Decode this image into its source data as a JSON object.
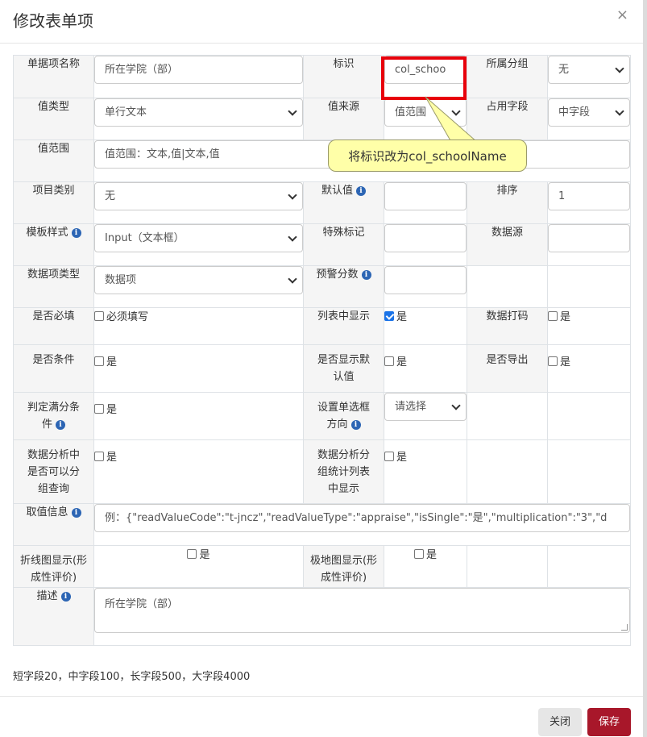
{
  "title": "修改表单项",
  "close_glyph": "×",
  "info_glyph": "i",
  "rows": {
    "name_label": "单据项名称",
    "name_value": "所在学院（部）",
    "key_label": "标识",
    "key_value": "col_schoo",
    "group_label": "所属分组",
    "group_value": "无",
    "type_label": "值类型",
    "type_value": "单行文本",
    "source_label": "值来源",
    "source_value": "值范围",
    "field_label": "占用字段",
    "field_value": "中字段",
    "range_label": "值范围",
    "range_placeholder": "值范围：文本,值|文本,值",
    "category_label": "项目类别",
    "category_value": "无",
    "default_label": "默认值",
    "sort_label": "排序",
    "sort_value": "1",
    "template_label": "模板样式",
    "template_value": "Input（文本框）",
    "special_label": "特殊标记",
    "datasource_label": "数据源",
    "itemtype_label": "数据项类型",
    "itemtype_value": "数据项",
    "warning_label": "预警分数",
    "required_label": "是否必填",
    "required_check": "必须填写",
    "list_label": "列表中显示",
    "yes": "是",
    "mask_label": "数据打码",
    "condition_label": "是否条件",
    "show_default_label": "是否显示默认值",
    "export_label": "是否导出",
    "fullscore_label": "判定满分条件",
    "radio_dir_label": "设置单选框方向",
    "radio_dir_value": "请选择",
    "group_query_label": "数据分析中是否可以分组查询",
    "group_stats_label": "数据分析分组统计列表中显示",
    "readvalue_label": "取值信息",
    "readvalue_placeholder": "例：{\"readValueCode\":\"t-jncz\",\"readValueType\":\"appraise\",\"isSingle\":\"是\",\"multiplication\":\"3\",\"d",
    "line_label": "折线图显示(形成性评价)",
    "polar_label": "极地图显示(形成性评价)",
    "desc_label": "描述",
    "desc_value": "所在学院（部）"
  },
  "tooltip": "将标识改为col_schoolName",
  "footnote": "短字段20，中字段100，长字段500，大字段4000",
  "buttons": {
    "close": "关闭",
    "save": "保存"
  },
  "colors": {
    "highlight": "#e8000b",
    "save_button": "#a8172a",
    "tooltip_bg": "#ffffa8",
    "info_icon": "#2c65b4"
  }
}
